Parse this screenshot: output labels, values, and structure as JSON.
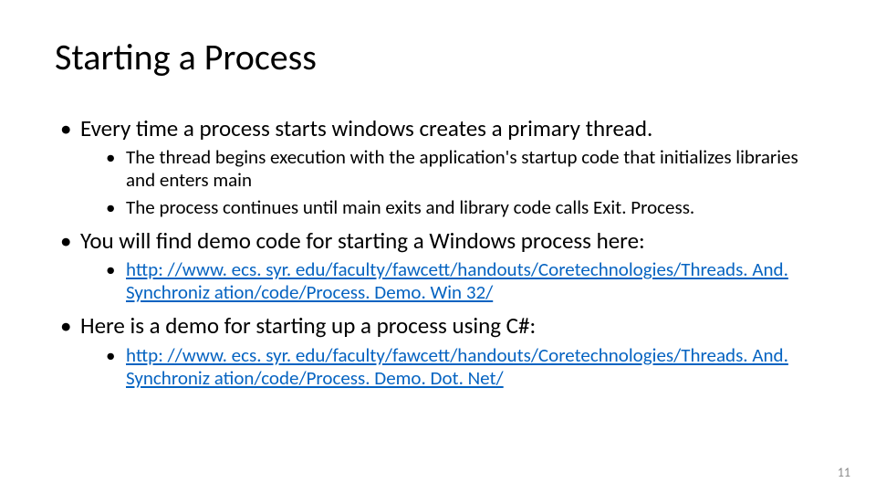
{
  "title": "Starting a Process",
  "bullets": {
    "p1": "Every time a process starts windows creates a primary thread.",
    "p1a": "The thread begins execution with the application's startup code that initializes libraries and enters main",
    "p1b": "The process continues until main exits and library code calls Exit. Process.",
    "p2": "You will find demo code for starting a Windows process here:",
    "p2link": "http: //www. ecs. syr. edu/faculty/fawcett/handouts/Coretechnologies/Threads. And. Synchroniz ation/code/Process. Demo. Win 32/",
    "p3": "Here is a demo for starting up a process using C#:",
    "p3link": "http: //www. ecs. syr. edu/faculty/fawcett/handouts/Coretechnologies/Threads. And. Synchroniz ation/code/Process. Demo. Dot. Net/"
  },
  "page_number": "11"
}
